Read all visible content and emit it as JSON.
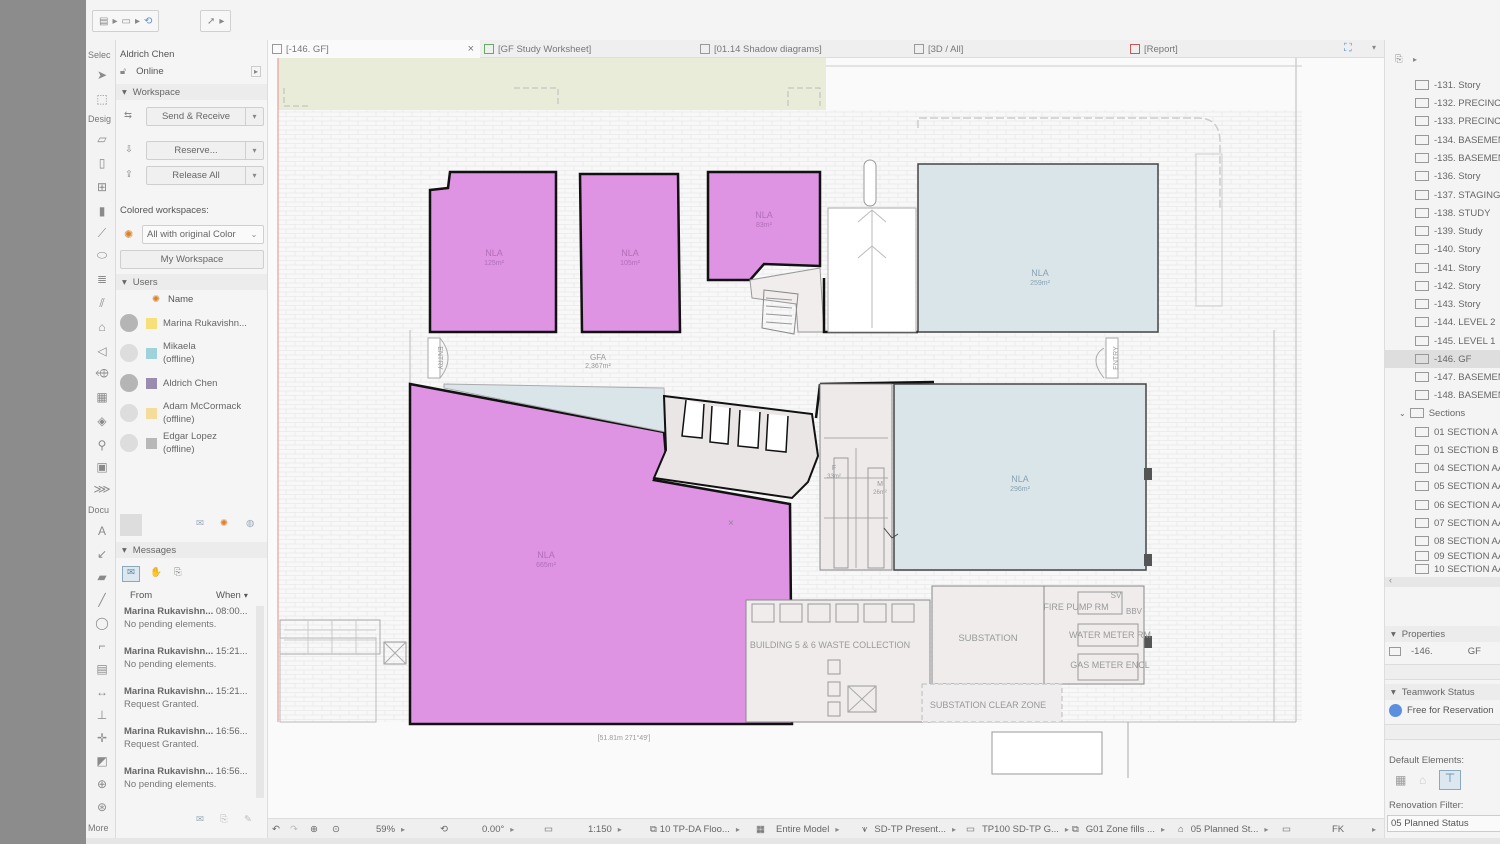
{
  "toolbox": {
    "select_label": "Selec",
    "design_label": "Desig",
    "document_label": "Docu",
    "more_label": "More"
  },
  "teamwork": {
    "user_name": "Aldrich Chen",
    "status": "Online",
    "workspace_header": "Workspace",
    "send_receive": "Send & Receive",
    "reserve": "Reserve...",
    "release_all": "Release All",
    "colored_label": "Colored workspaces:",
    "colored_value": "All with original Color",
    "my_workspace": "My Workspace",
    "users_header": "Users",
    "name_col": "Name",
    "users": [
      {
        "name": "Marina Rukavishn...",
        "status": "",
        "color": "#f7e07a"
      },
      {
        "name": "Mikaela",
        "status": "(offline)",
        "color": "#9fd3dc"
      },
      {
        "name": "Aldrich Chen",
        "status": "",
        "color": "#9c8bb0"
      },
      {
        "name": "Adam McCormack",
        "status": "(offline)",
        "color": "#f6dc9a"
      },
      {
        "name": "Edgar Lopez",
        "status": "(offline)",
        "color": "#b8b8b8"
      }
    ],
    "messages_header": "Messages",
    "from_col": "From",
    "when_col": "When",
    "messages": [
      {
        "from": "Marina Rukavishn...",
        "time": "08:00...",
        "text": "No pending elements."
      },
      {
        "from": "Marina Rukavishn...",
        "time": "15:21...",
        "text": "No pending elements."
      },
      {
        "from": "Marina Rukavishn...",
        "time": "15:21...",
        "text": "Request Granted."
      },
      {
        "from": "Marina Rukavishn...",
        "time": "16:56...",
        "text": "Request Granted."
      },
      {
        "from": "Marina Rukavishn...",
        "time": "16:56...",
        "text": "No pending elements."
      }
    ]
  },
  "tabs": [
    {
      "label": "[-146. GF]",
      "close": "×"
    },
    {
      "label": "[GF Study Worksheet]"
    },
    {
      "label": "[01.14 Shadow diagrams]"
    },
    {
      "label": "[3D / All]"
    },
    {
      "label": "[Report]"
    }
  ],
  "plan": {
    "zones": [
      {
        "name": "NLA",
        "area": "125m²"
      },
      {
        "name": "NLA",
        "area": "105m²"
      },
      {
        "name": "NLA",
        "area": "83m²"
      },
      {
        "name": "NLA",
        "area": "259m²"
      },
      {
        "name": "NLA",
        "area": "665m²"
      },
      {
        "name": "NLA",
        "area": "296m²"
      }
    ],
    "gfa_label": "GFA",
    "gfa_value": "2,367m²",
    "entry_label": "ENTRY",
    "rooms": {
      "fire_pump": "FIRE PUMP RM",
      "substation": "SUBSTATION",
      "water_meter": "WATER METER RM",
      "gas_meter": "GAS METER ENCL",
      "waste": "BUILDING 5 & 6 WASTE COLLECTION",
      "clear_zone": "SUBSTATION CLEAR ZONE",
      "sv": "SV",
      "bbv": "BBV",
      "f": "F",
      "f_area": "33m²",
      "m": "M",
      "m_area": "26m²"
    },
    "dimension": "[51.81m 271°49']"
  },
  "navigator": {
    "stories": [
      "-131. Story",
      "-132. PRECINCT",
      "-133. PRECINCT",
      "-134. BASEMENT",
      "-135. BASEMENT",
      "-136. Story",
      "-137. STAGING",
      "-138. STUDY",
      "-139. Study",
      "-140. Story",
      "-141. Story",
      "-142. Story",
      "-143. Story",
      "-144. LEVEL 2",
      "-145. LEVEL 1",
      "-146. GF",
      "-147. BASEMENT",
      "-148. BASEMENT"
    ],
    "selected": "-146. GF",
    "sections_label": "Sections",
    "sections": [
      "01 SECTION A (",
      "01 SECTION B (",
      "04 SECTION AA",
      "05 SECTION AA",
      "06 SECTION AA",
      "07 SECTION AA",
      "08 SECTION AA",
      "09 SECTION AA",
      "10 SECTION AA"
    ]
  },
  "properties": {
    "header": "Properties",
    "story_num": "-146.",
    "story_name": "GF",
    "teamwork_header": "Teamwork Status",
    "teamwork_status": "Free for Reservation",
    "default_elements": "Default Elements:",
    "renovation_label": "Renovation Filter:",
    "renovation_value": "05 Planned Status"
  },
  "statusbar": {
    "zoom": "59%",
    "angle": "0.00°",
    "scale": "1:150",
    "layer": "10 TP-DA Floo...",
    "model": "Entire Model",
    "pen": "SD-TP Present...",
    "mvo": "TP100 SD-TP G...",
    "override": "G01 Zone fills ...",
    "reno": "05 Planned St...",
    "units": "FK"
  },
  "colors": {
    "zone_magenta": "#de93e3",
    "zone_blue": "#dae5ea",
    "site_green": "#e9ecd9"
  }
}
